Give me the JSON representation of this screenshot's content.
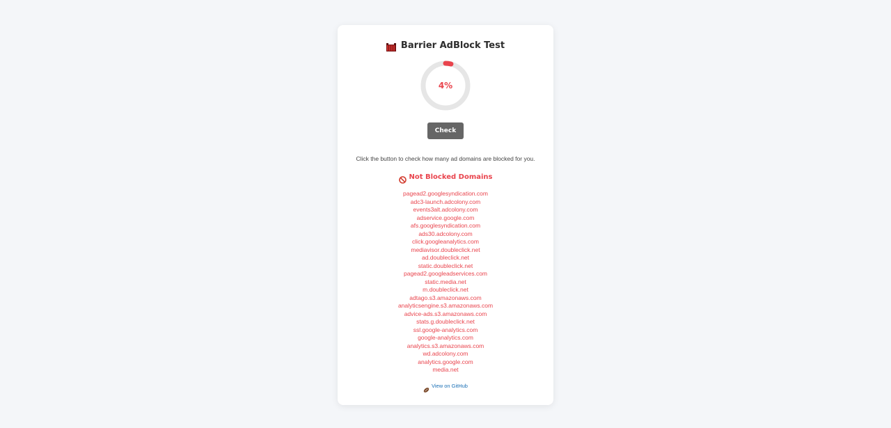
{
  "app": {
    "title": "Barrier AdBlock Test",
    "title_icon": "barrier-icon"
  },
  "gauge": {
    "percent": 4,
    "label": "4%",
    "accent_color": "#e9444d",
    "track_color": "#e6e6e6"
  },
  "check_button": {
    "label": "Check",
    "color": "#666666"
  },
  "description": "Click the button to check how many ad domains are blocked for you.",
  "not_blocked": {
    "icon": "prohibited-icon",
    "title": "Not Blocked Domains",
    "domains": [
      "pagead2.googlesyndication.com",
      "adc3-launch.adcolony.com",
      "events3alt.adcolony.com",
      "adservice.google.com",
      "afs.googlesyndication.com",
      "ads30.adcolony.com",
      "click.googleanalytics.com",
      "mediavisor.doubleclick.net",
      "ad.doubleclick.net",
      "static.doubleclick.net",
      "pagead2.googleadservices.com",
      "static.media.net",
      "m.doubleclick.net",
      "adtago.s3.amazonaws.com",
      "analyticsengine.s3.amazonaws.com",
      "advice-ads.s3.amazonaws.com",
      "stats.g.doubleclick.net",
      "ssl.google-analytics.com",
      "google-analytics.com",
      "analytics.s3.amazonaws.com",
      "wd.adcolony.com",
      "analytics.google.com",
      "media.net"
    ]
  },
  "footer": {
    "icon": "rugby-ball-icon",
    "link_label": "View on GitHub"
  }
}
